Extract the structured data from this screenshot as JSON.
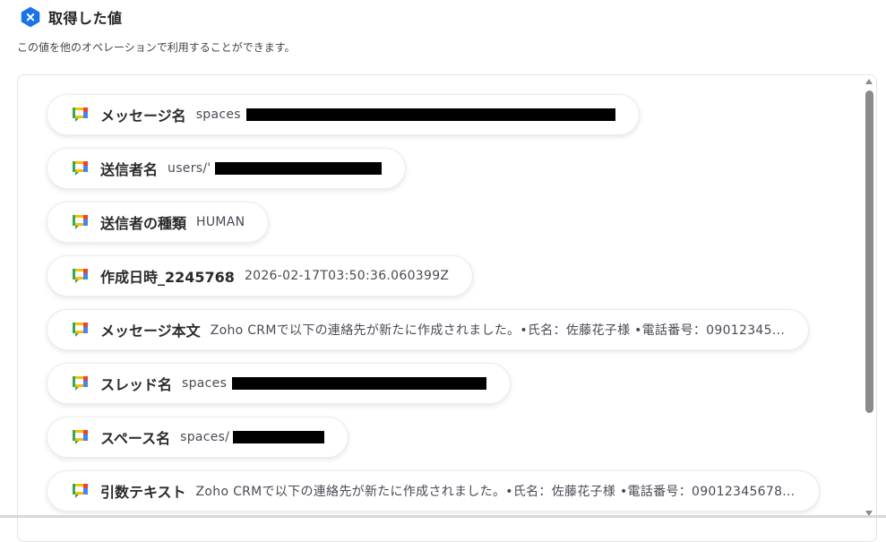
{
  "header": {
    "title": "取得した値",
    "subtitle": "この値を他のオペレーションで利用することができます。",
    "icon": "x-badge-icon",
    "accent_color": "#1a73e8"
  },
  "items": [
    {
      "label": "メッセージ名",
      "value": "spaces",
      "icon": "google-chat-icon"
    },
    {
      "label": "送信者名",
      "value": "users/'",
      "icon": "google-chat-icon"
    },
    {
      "label": "送信者の種類",
      "value": "HUMAN",
      "icon": "google-chat-icon"
    },
    {
      "label": "作成日時_2245768",
      "value": "2026-02-17T03:50:36.060399Z",
      "icon": "google-chat-icon"
    },
    {
      "label": "メッセージ本文",
      "value": "Zoho CRMで以下の連絡先が新たに作成されました。•氏名：佐藤花子様 •電話番号：09012345...",
      "icon": "google-chat-icon"
    },
    {
      "label": "スレッド名",
      "value": "spaces",
      "icon": "google-chat-icon"
    },
    {
      "label": "スペース名",
      "value": "spaces/",
      "icon": "google-chat-icon"
    },
    {
      "label": "引数テキスト",
      "value": "Zoho CRMで以下の連絡先が新たに作成されました。•氏名：佐藤花子様 •電話番号：09012345678...",
      "icon": "google-chat-icon"
    }
  ]
}
